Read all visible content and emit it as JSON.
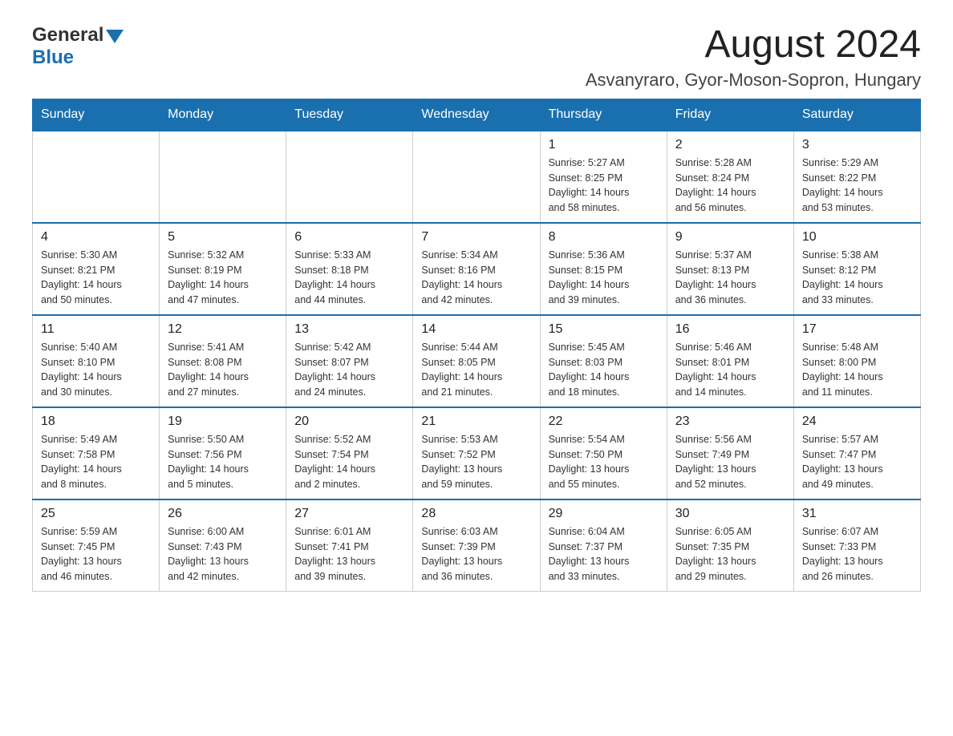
{
  "header": {
    "logo_general": "General",
    "logo_blue": "Blue",
    "month_title": "August 2024",
    "location": "Asvanyraro, Gyor-Moson-Sopron, Hungary"
  },
  "weekdays": [
    "Sunday",
    "Monday",
    "Tuesday",
    "Wednesday",
    "Thursday",
    "Friday",
    "Saturday"
  ],
  "weeks": [
    {
      "days": [
        {
          "num": "",
          "info": ""
        },
        {
          "num": "",
          "info": ""
        },
        {
          "num": "",
          "info": ""
        },
        {
          "num": "",
          "info": ""
        },
        {
          "num": "1",
          "info": "Sunrise: 5:27 AM\nSunset: 8:25 PM\nDaylight: 14 hours\nand 58 minutes."
        },
        {
          "num": "2",
          "info": "Sunrise: 5:28 AM\nSunset: 8:24 PM\nDaylight: 14 hours\nand 56 minutes."
        },
        {
          "num": "3",
          "info": "Sunrise: 5:29 AM\nSunset: 8:22 PM\nDaylight: 14 hours\nand 53 minutes."
        }
      ]
    },
    {
      "days": [
        {
          "num": "4",
          "info": "Sunrise: 5:30 AM\nSunset: 8:21 PM\nDaylight: 14 hours\nand 50 minutes."
        },
        {
          "num": "5",
          "info": "Sunrise: 5:32 AM\nSunset: 8:19 PM\nDaylight: 14 hours\nand 47 minutes."
        },
        {
          "num": "6",
          "info": "Sunrise: 5:33 AM\nSunset: 8:18 PM\nDaylight: 14 hours\nand 44 minutes."
        },
        {
          "num": "7",
          "info": "Sunrise: 5:34 AM\nSunset: 8:16 PM\nDaylight: 14 hours\nand 42 minutes."
        },
        {
          "num": "8",
          "info": "Sunrise: 5:36 AM\nSunset: 8:15 PM\nDaylight: 14 hours\nand 39 minutes."
        },
        {
          "num": "9",
          "info": "Sunrise: 5:37 AM\nSunset: 8:13 PM\nDaylight: 14 hours\nand 36 minutes."
        },
        {
          "num": "10",
          "info": "Sunrise: 5:38 AM\nSunset: 8:12 PM\nDaylight: 14 hours\nand 33 minutes."
        }
      ]
    },
    {
      "days": [
        {
          "num": "11",
          "info": "Sunrise: 5:40 AM\nSunset: 8:10 PM\nDaylight: 14 hours\nand 30 minutes."
        },
        {
          "num": "12",
          "info": "Sunrise: 5:41 AM\nSunset: 8:08 PM\nDaylight: 14 hours\nand 27 minutes."
        },
        {
          "num": "13",
          "info": "Sunrise: 5:42 AM\nSunset: 8:07 PM\nDaylight: 14 hours\nand 24 minutes."
        },
        {
          "num": "14",
          "info": "Sunrise: 5:44 AM\nSunset: 8:05 PM\nDaylight: 14 hours\nand 21 minutes."
        },
        {
          "num": "15",
          "info": "Sunrise: 5:45 AM\nSunset: 8:03 PM\nDaylight: 14 hours\nand 18 minutes."
        },
        {
          "num": "16",
          "info": "Sunrise: 5:46 AM\nSunset: 8:01 PM\nDaylight: 14 hours\nand 14 minutes."
        },
        {
          "num": "17",
          "info": "Sunrise: 5:48 AM\nSunset: 8:00 PM\nDaylight: 14 hours\nand 11 minutes."
        }
      ]
    },
    {
      "days": [
        {
          "num": "18",
          "info": "Sunrise: 5:49 AM\nSunset: 7:58 PM\nDaylight: 14 hours\nand 8 minutes."
        },
        {
          "num": "19",
          "info": "Sunrise: 5:50 AM\nSunset: 7:56 PM\nDaylight: 14 hours\nand 5 minutes."
        },
        {
          "num": "20",
          "info": "Sunrise: 5:52 AM\nSunset: 7:54 PM\nDaylight: 14 hours\nand 2 minutes."
        },
        {
          "num": "21",
          "info": "Sunrise: 5:53 AM\nSunset: 7:52 PM\nDaylight: 13 hours\nand 59 minutes."
        },
        {
          "num": "22",
          "info": "Sunrise: 5:54 AM\nSunset: 7:50 PM\nDaylight: 13 hours\nand 55 minutes."
        },
        {
          "num": "23",
          "info": "Sunrise: 5:56 AM\nSunset: 7:49 PM\nDaylight: 13 hours\nand 52 minutes."
        },
        {
          "num": "24",
          "info": "Sunrise: 5:57 AM\nSunset: 7:47 PM\nDaylight: 13 hours\nand 49 minutes."
        }
      ]
    },
    {
      "days": [
        {
          "num": "25",
          "info": "Sunrise: 5:59 AM\nSunset: 7:45 PM\nDaylight: 13 hours\nand 46 minutes."
        },
        {
          "num": "26",
          "info": "Sunrise: 6:00 AM\nSunset: 7:43 PM\nDaylight: 13 hours\nand 42 minutes."
        },
        {
          "num": "27",
          "info": "Sunrise: 6:01 AM\nSunset: 7:41 PM\nDaylight: 13 hours\nand 39 minutes."
        },
        {
          "num": "28",
          "info": "Sunrise: 6:03 AM\nSunset: 7:39 PM\nDaylight: 13 hours\nand 36 minutes."
        },
        {
          "num": "29",
          "info": "Sunrise: 6:04 AM\nSunset: 7:37 PM\nDaylight: 13 hours\nand 33 minutes."
        },
        {
          "num": "30",
          "info": "Sunrise: 6:05 AM\nSunset: 7:35 PM\nDaylight: 13 hours\nand 29 minutes."
        },
        {
          "num": "31",
          "info": "Sunrise: 6:07 AM\nSunset: 7:33 PM\nDaylight: 13 hours\nand 26 minutes."
        }
      ]
    }
  ]
}
